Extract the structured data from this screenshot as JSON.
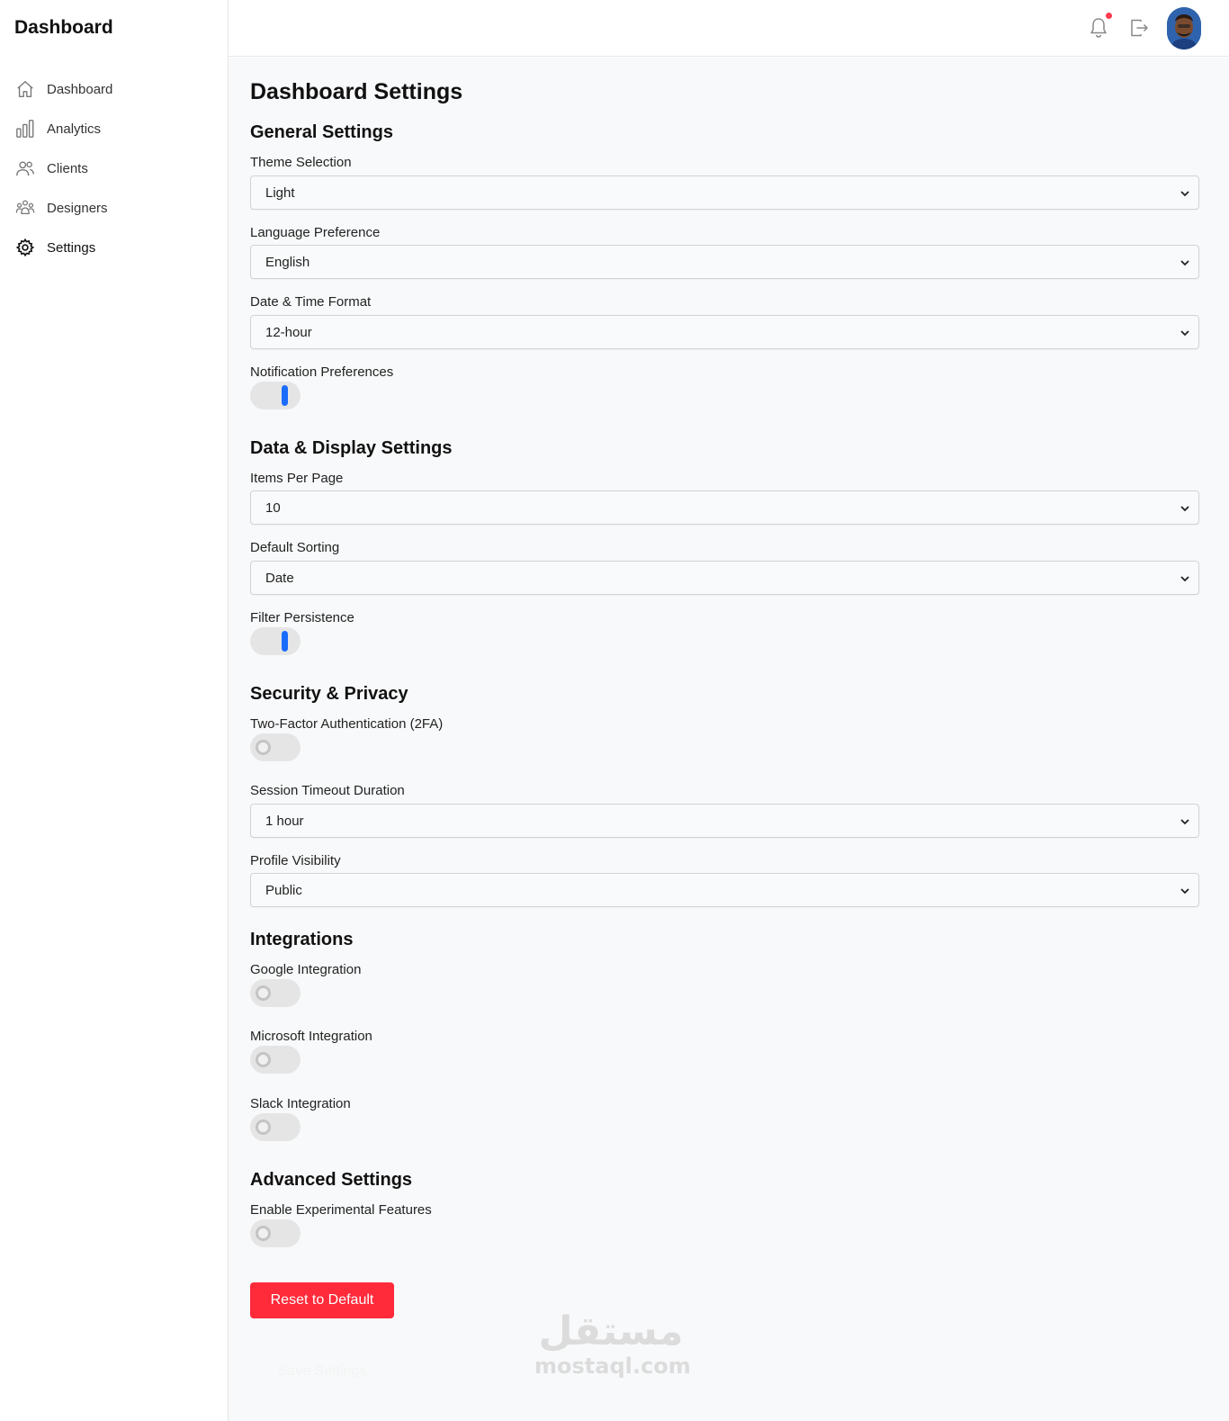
{
  "sidebar": {
    "brand": "Dashboard",
    "items": [
      {
        "label": "Dashboard",
        "icon": "home-icon"
      },
      {
        "label": "Analytics",
        "icon": "bar-chart-icon"
      },
      {
        "label": "Clients",
        "icon": "users-icon"
      },
      {
        "label": "Designers",
        "icon": "group-icon"
      },
      {
        "label": "Settings",
        "icon": "gear-icon",
        "active": true
      }
    ]
  },
  "topbar": {
    "icons": [
      "bell-icon",
      "logout-icon",
      "avatar"
    ],
    "notification_dot_color": "#ff3b4e"
  },
  "page": {
    "title": "Dashboard Settings"
  },
  "general": {
    "title": "General Settings",
    "theme_label": "Theme Selection",
    "theme_value": "Light",
    "language_label": "Language Preference",
    "language_value": "English",
    "datetime_label": "Date & Time Format",
    "datetime_value": "12-hour",
    "notification_label": "Notification Preferences",
    "notification_on": true
  },
  "data_display": {
    "title": "Data & Display Settings",
    "items_label": "Items Per Page",
    "items_value": "10",
    "sorting_label": "Default Sorting",
    "sorting_value": "Date",
    "filter_label": "Filter Persistence",
    "filter_on": true
  },
  "security": {
    "title": "Security & Privacy",
    "twofa_label": "Two-Factor Authentication (2FA)",
    "twofa_on": false,
    "timeout_label": "Session Timeout Duration",
    "timeout_value": "1 hour",
    "visibility_label": "Profile Visibility",
    "visibility_value": "Public"
  },
  "integrations": {
    "title": "Integrations",
    "google_label": "Google Integration",
    "google_on": false,
    "microsoft_label": "Microsoft Integration",
    "microsoft_on": false,
    "slack_label": "Slack Integration",
    "slack_on": false
  },
  "advanced": {
    "title": "Advanced Settings",
    "experimental_label": "Enable Experimental Features",
    "experimental_on": false
  },
  "actions": {
    "reset_label": "Reset to Default",
    "save_label": "Save Settings"
  },
  "watermark": {
    "arabic": "مستقل",
    "latin": "mostaql.com"
  },
  "colors": {
    "accent": "#1a6cff",
    "danger": "#ff2a3a",
    "background": "#f8f9fa"
  }
}
